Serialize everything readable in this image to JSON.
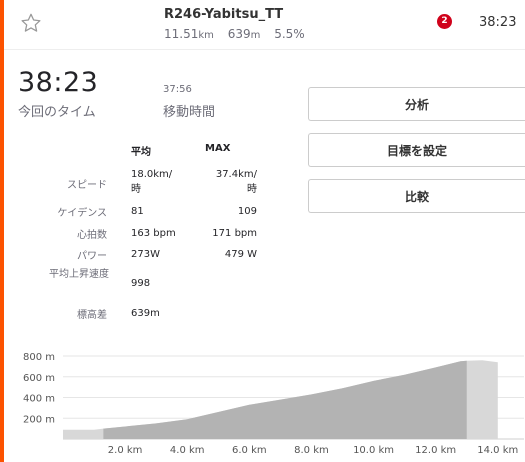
{
  "header": {
    "segment_title": "R246-Yabitsu_TT",
    "distance": "11.51",
    "distance_unit": "km",
    "elevation": "639",
    "elevation_unit": "m",
    "grade": "5.5%",
    "notification_count": "2",
    "time": "38:23"
  },
  "effort": {
    "time": "38:23",
    "time_label": "今回のタイム",
    "moving_time": "37:56",
    "moving_time_label": "移動時間"
  },
  "buttons": {
    "analyze": "分析",
    "set_goal": "目標を設定",
    "compare": "比較"
  },
  "stats": {
    "col_avg": "平均",
    "col_max": "MAX",
    "rows": [
      {
        "label": "スピード",
        "avg": "18.0km/\n時",
        "max": "37.4km/\n時"
      },
      {
        "label": "ケイデンス",
        "avg": "81",
        "max": "109"
      },
      {
        "label": "心拍数",
        "avg": "163 bpm",
        "max": "171 bpm"
      },
      {
        "label": "パワー",
        "avg": "273W",
        "max": "479 W"
      },
      {
        "label": "平均上昇速度",
        "avg": "998",
        "max": ""
      },
      {
        "label": "標高差",
        "avg": "639m",
        "max": ""
      }
    ]
  },
  "colors": {
    "accent": "#fc5200",
    "badge": "#d0021b",
    "profile_fill": "#b3b3b3",
    "profile_outside": "#d8d8d8"
  },
  "chart_data": {
    "type": "area",
    "x": [
      0,
      1,
      1.3,
      2,
      3,
      4,
      5,
      6,
      7,
      8,
      9,
      10,
      11,
      12,
      12.8,
      13.0,
      13.5,
      14.0
    ],
    "y": [
      90,
      90,
      100,
      120,
      150,
      190,
      260,
      330,
      380,
      430,
      490,
      560,
      620,
      690,
      750,
      755,
      760,
      740
    ],
    "highlight_range": [
      1.3,
      13.0
    ],
    "xlim": [
      0,
      14.2
    ],
    "ylim": [
      0,
      800
    ],
    "x_ticks": [
      "2.0 km",
      "4.0 km",
      "6.0 km",
      "8.0 km",
      "10.0 km",
      "12.0 km",
      "14.0 km"
    ],
    "x_tick_values": [
      2,
      4,
      6,
      8,
      10,
      12,
      14
    ],
    "y_ticks": [
      "800 m",
      "600 m",
      "400 m",
      "200 m"
    ],
    "y_tick_values": [
      800,
      600,
      400,
      200
    ],
    "grid": true
  }
}
